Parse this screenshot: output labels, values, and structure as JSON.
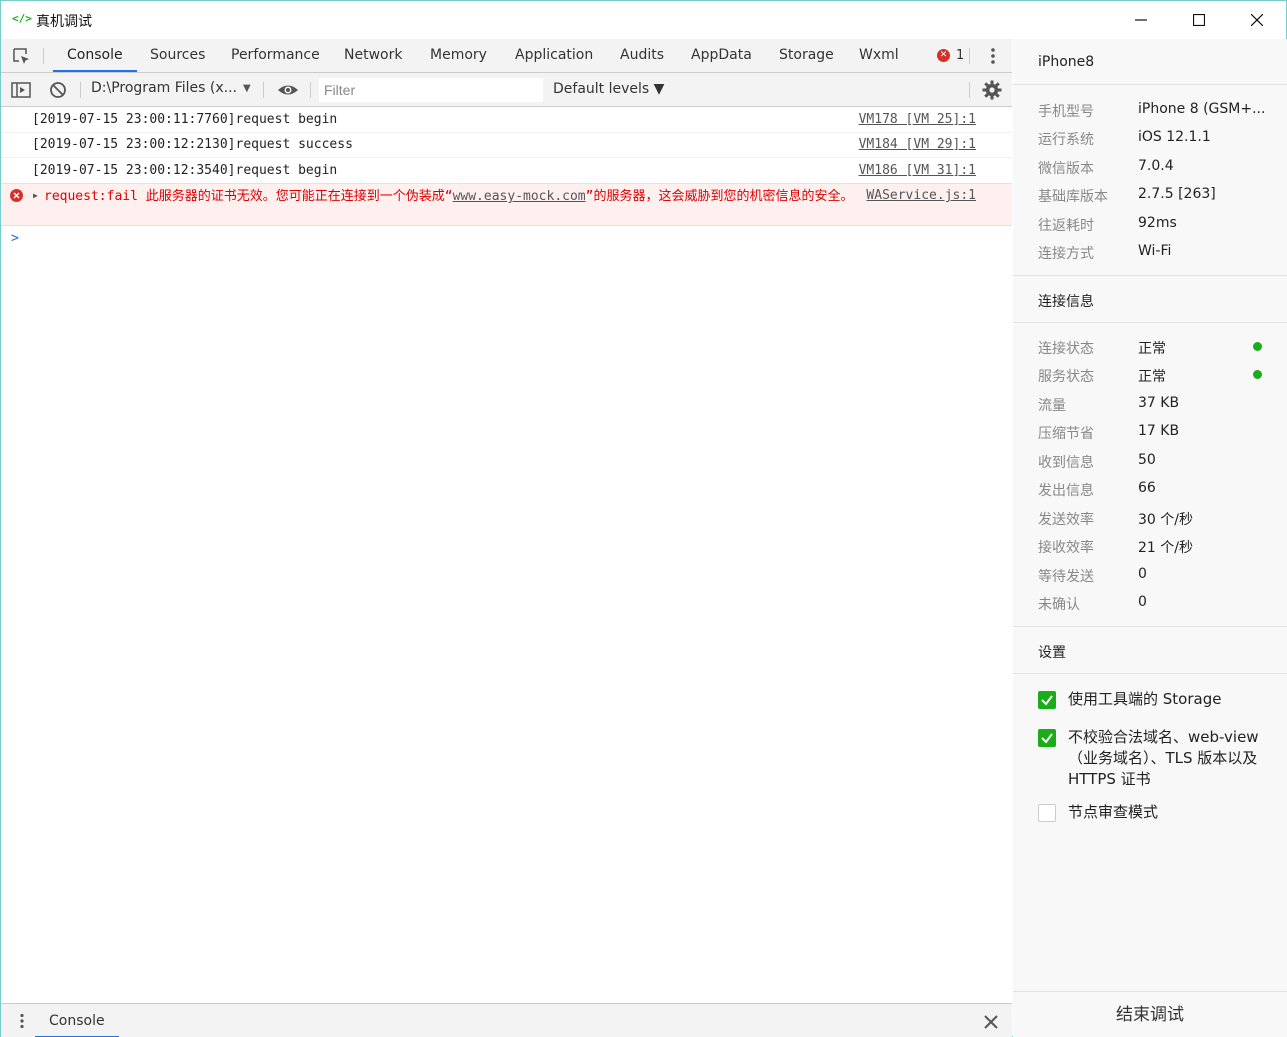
{
  "window": {
    "title": "真机调试",
    "app_icon": "</>"
  },
  "devtools": {
    "tabs": [
      {
        "label": "Console"
      },
      {
        "label": "Sources"
      },
      {
        "label": "Performance"
      },
      {
        "label": "Network"
      },
      {
        "label": "Memory"
      },
      {
        "label": "Application"
      },
      {
        "label": "Audits"
      },
      {
        "label": "AppData"
      },
      {
        "label": "Storage"
      },
      {
        "label": "Wxml"
      }
    ],
    "active_tab": "Console",
    "error_count": "1",
    "context": "D:\\Program Files (x...",
    "filter_placeholder": "Filter",
    "levels": "Default levels ▼"
  },
  "console": {
    "rows": [
      {
        "msg": "[2019-07-15 23:00:11:7760]request begin",
        "src": "VM178 [VM 25]:1"
      },
      {
        "msg": "[2019-07-15 23:00:12:2130]request success",
        "src": "VM184 [VM 29]:1"
      },
      {
        "msg": "[2019-07-15 23:00:12:3540]request begin",
        "src": "VM186 [VM 31]:1"
      }
    ],
    "error": {
      "prefix": "request:fail 此服务器的证书无效。您可能正在连接到一个伪装成“",
      "link": "www.easy-mock.com",
      "suffix": "”的服务器，这会威胁到您的机密信息的安全。",
      "src": "WAService.js:1"
    },
    "prompt": ">"
  },
  "drawer": {
    "tab": "Console"
  },
  "device": {
    "name": "iPhone8",
    "info": [
      {
        "k": "手机型号",
        "v": "iPhone 8 (GSM+..."
      },
      {
        "k": "运行系统",
        "v": "iOS 12.1.1"
      },
      {
        "k": "微信版本",
        "v": "7.0.4"
      },
      {
        "k": "基础库版本",
        "v": "2.7.5 [263]"
      },
      {
        "k": "往返耗时",
        "v": "92ms"
      },
      {
        "k": "连接方式",
        "v": "Wi-Fi"
      }
    ],
    "conn_title": "连接信息",
    "conn": [
      {
        "k": "连接状态",
        "v": "正常"
      },
      {
        "k": "服务状态",
        "v": "正常"
      },
      {
        "k": "流量",
        "v": "37 KB"
      },
      {
        "k": "压缩节省",
        "v": "17 KB"
      },
      {
        "k": "收到信息",
        "v": "50"
      },
      {
        "k": "发出信息",
        "v": "66"
      },
      {
        "k": "发送效率",
        "v": "30 个/秒"
      },
      {
        "k": "接收效率",
        "v": "21 个/秒"
      },
      {
        "k": "等待发送",
        "v": "0"
      },
      {
        "k": "未确认",
        "v": "0"
      }
    ],
    "settings_title": "设置",
    "settings": [
      {
        "label": "使用工具端的 Storage",
        "checked": true
      },
      {
        "label": "不校验合法域名、web-view（业务域名）、TLS 版本以及 HTTPS 证书",
        "checked": true
      },
      {
        "label": "节点审查模式",
        "checked": false
      }
    ],
    "end_button": "结束调试"
  },
  "colors": {
    "accent": "#1a73e8",
    "success": "#1aad19",
    "error": "#d93025"
  }
}
